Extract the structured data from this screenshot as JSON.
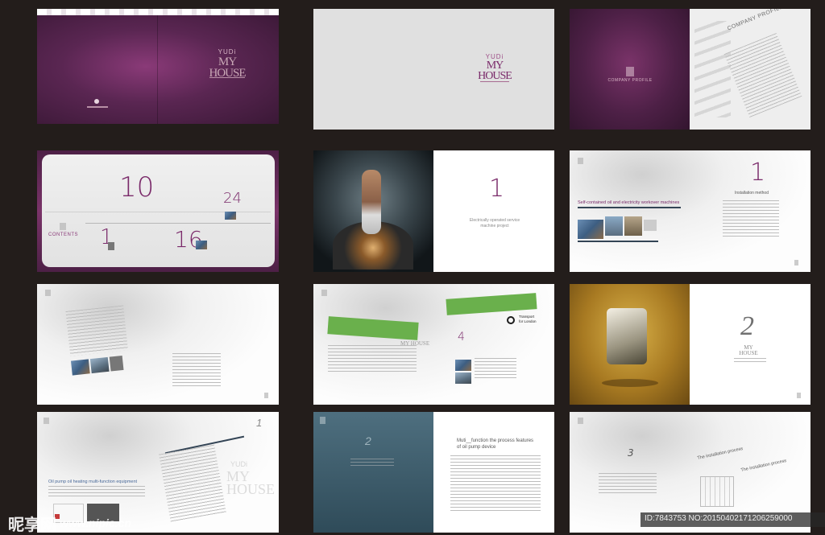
{
  "spread1": {
    "brand_small": "YUDi",
    "brand_big": "MY HOUSE"
  },
  "spread2": {
    "brand_small": "YUDi",
    "brand_big": "MY HOUSE"
  },
  "spread3": {
    "left_label": "COMPANY PROFILE",
    "right_title": "COMPANY PROFILE"
  },
  "spread4": {
    "contents_label": "CONTENTS",
    "nums": [
      "10",
      "24",
      "1",
      "16"
    ]
  },
  "spread5": {
    "num": "1",
    "subtitle": "Electrically operated service machine project"
  },
  "spread6": {
    "headline": "Self-contained oil and electricity workover machines",
    "num": "1",
    "side_title": "Installation method"
  },
  "spread8": {
    "num": "4",
    "tfl_line1": "Transport",
    "tfl_line2": "for London",
    "brand": "MY HOUSE"
  },
  "spread9": {
    "num": "2",
    "brand": "MY HOUSE"
  },
  "spread10": {
    "num": "1",
    "title": "Oil pump oil heating multi-function equipment",
    "brand_small": "YUDi",
    "brand_big": "MY HOUSE"
  },
  "spread11": {
    "num": "2",
    "title": "Muti__function the process features of oil pump device"
  },
  "spread12": {
    "num": "3",
    "title1": "The installation process",
    "title2": "The installation process"
  },
  "watermark": {
    "logo_text": "昵享网",
    "url": "www.nipic.cn",
    "id_text": "ID:7843753 NO:20150402171206259000"
  },
  "colors": {
    "accent": "#7a2a6a",
    "background": "#231d1b",
    "green": "#6ab04c"
  }
}
